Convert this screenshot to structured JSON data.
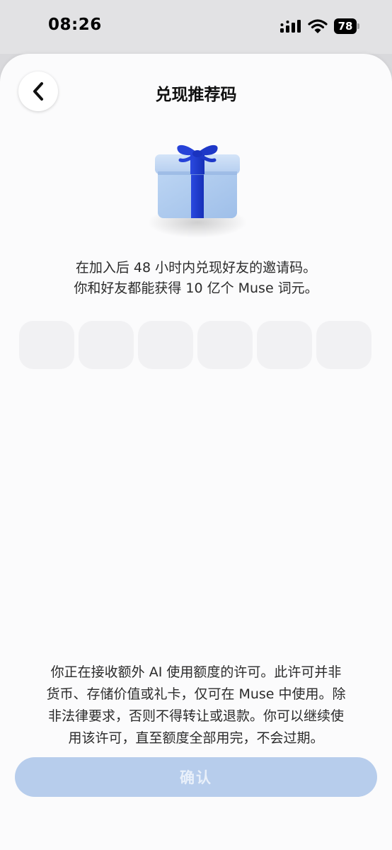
{
  "status_bar": {
    "time": "08:26",
    "battery": "78",
    "icons": [
      "signal-icon",
      "wifi-icon",
      "battery-icon"
    ]
  },
  "header": {
    "back_icon": "chevron-left-icon",
    "title": "兑现推荐码"
  },
  "illustration": {
    "icon": "gift-box-icon",
    "box_color": "#aecbef",
    "ribbon_color": "#1f3fd6"
  },
  "description": {
    "line1": "在加入后 48 小时内兑现好友的邀请码。",
    "line2": "你和好友都能获得 10 亿个 Muse 词元。"
  },
  "code_input": {
    "boxes": [
      "",
      "",
      "",
      "",
      "",
      ""
    ]
  },
  "disclaimer": {
    "lines": [
      "你正在接收额外 AI 使用额度的许可。此许可并非",
      "货币、存储价值或礼卡，仅可在 Muse 中使用。除",
      "非法律要求，否则不得转让或退款。你可以继续使",
      "用该许可，直至额度全部用完，不会过期。"
    ]
  },
  "confirm": {
    "label": "确认",
    "color": "#b7cdec"
  }
}
